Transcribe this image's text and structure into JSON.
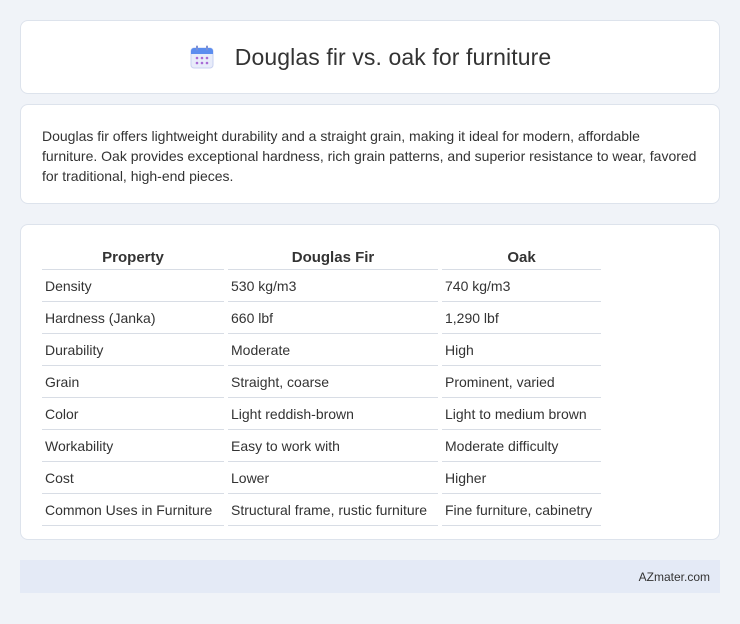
{
  "header": {
    "title": "Douglas fir vs. oak for furniture",
    "icon": "calendar-icon"
  },
  "intro": {
    "text": "Douglas fir offers lightweight durability and a straight grain, making it ideal for modern, affordable furniture. Oak provides exceptional hardness, rich grain patterns, and superior resistance to wear, favored for traditional, high-end pieces."
  },
  "table": {
    "headers": [
      "Property",
      "Douglas Fir",
      "Oak"
    ],
    "rows": [
      [
        "Density",
        "530 kg/m3",
        "740 kg/m3"
      ],
      [
        "Hardness (Janka)",
        "660 lbf",
        "1,290 lbf"
      ],
      [
        "Durability",
        "Moderate",
        "High"
      ],
      [
        "Grain",
        "Straight, coarse",
        "Prominent, varied"
      ],
      [
        "Color",
        "Light reddish-brown",
        "Light to medium brown"
      ],
      [
        "Workability",
        "Easy to work with",
        "Moderate difficulty"
      ],
      [
        "Cost",
        "Lower",
        "Higher"
      ],
      [
        "Common Uses in Furniture",
        "Structural frame, rustic furniture",
        "Fine furniture, cabinetry"
      ]
    ]
  },
  "footer": {
    "text": "AZmater.com"
  },
  "colors": {
    "background": "#f0f3f8",
    "card": "#ffffff",
    "footer_bg": "#e4eaf6",
    "text": "#333333"
  }
}
